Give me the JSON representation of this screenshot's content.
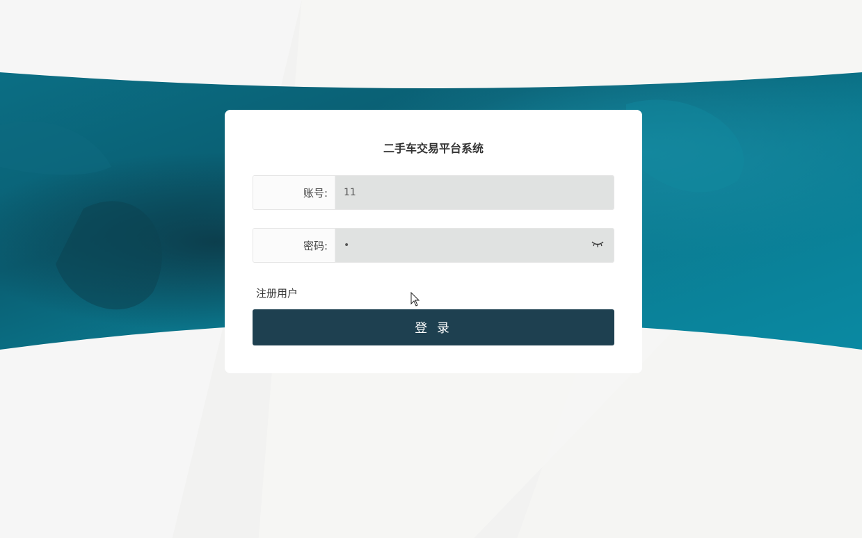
{
  "login": {
    "title": "二手车交易平台系统",
    "account_label": "账号:",
    "account_value": "11",
    "password_label": "密码:",
    "password_value": "1",
    "register_link": "注册用户",
    "login_button": "登 录"
  },
  "colors": {
    "band_teal": "#0a7f95",
    "button_bg": "#1e4050",
    "input_bg": "#e0e2e1"
  },
  "icons": {
    "password_toggle": "eye-closed-icon",
    "pointer": "mouse-cursor-icon"
  }
}
